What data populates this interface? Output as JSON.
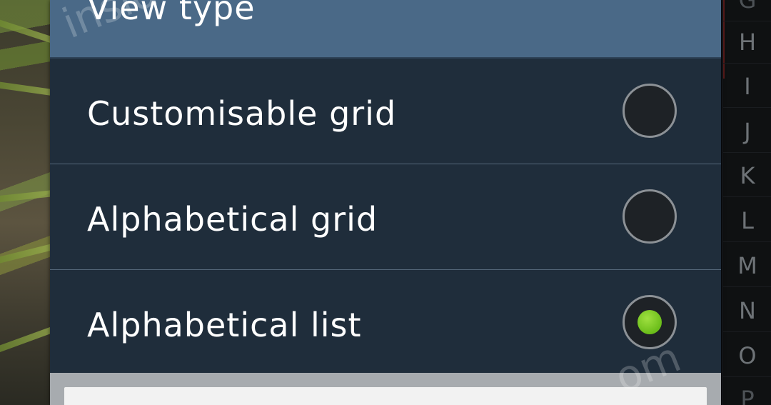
{
  "dialog": {
    "title": "View type",
    "options": [
      {
        "label": "Customisable grid",
        "selected": false
      },
      {
        "label": "Alphabetical grid",
        "selected": false
      },
      {
        "label": "Alphabetical list",
        "selected": true
      }
    ]
  },
  "index_strip": {
    "letters": [
      "H",
      "I",
      "J",
      "K",
      "L",
      "M",
      "N",
      "O"
    ]
  },
  "watermark": {
    "text_top": "insid",
    "text_bottom": "om"
  },
  "colors": {
    "header": "#4a6987",
    "dialog_body": "#1f2d3b",
    "selected_dot": "#7fcc2a"
  }
}
